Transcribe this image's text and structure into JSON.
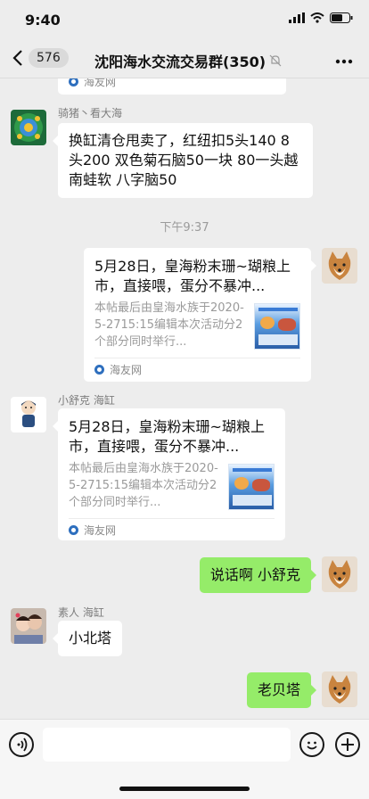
{
  "status_bar": {
    "time": "9:40"
  },
  "nav": {
    "unread_count": "576",
    "title": "沈阳海水交流交易群(350)"
  },
  "top_card_source": "海友网",
  "messages": {
    "m1": {
      "sender": "骑猪丶看大海",
      "text": "换缸清仓甩卖了，红纽扣5头140 8头200 双色菊石脑50一块 80一头越南蛙软 八字脑50"
    },
    "timestamp": "下午9:37",
    "card_self": {
      "title": "5月28日，皇海粉末珊~瑚粮上市，直接喂，蛋分不暴冲...",
      "desc": "本帖最后由皇海水族于2020-5-2715:15编辑本次活动分2个部分同时举行...",
      "source": "海友网"
    },
    "card_other": {
      "sender": "小舒克 海缸",
      "title": "5月28日，皇海粉末珊~瑚粮上市，直接喂，蛋分不暴冲...",
      "desc": "本帖最后由皇海水族于2020-5-2715:15编辑本次活动分2个部分同时举行...",
      "source": "海友网"
    },
    "m_self_1": {
      "text": "说话啊 小舒克"
    },
    "m_other_2": {
      "sender": "素人 海缸",
      "text": "小北塔"
    },
    "m_self_2": {
      "text": "老贝塔"
    }
  },
  "colors": {
    "background": "#ededed",
    "self_bubble": "#95ec69",
    "other_bubble": "#ffffff"
  }
}
